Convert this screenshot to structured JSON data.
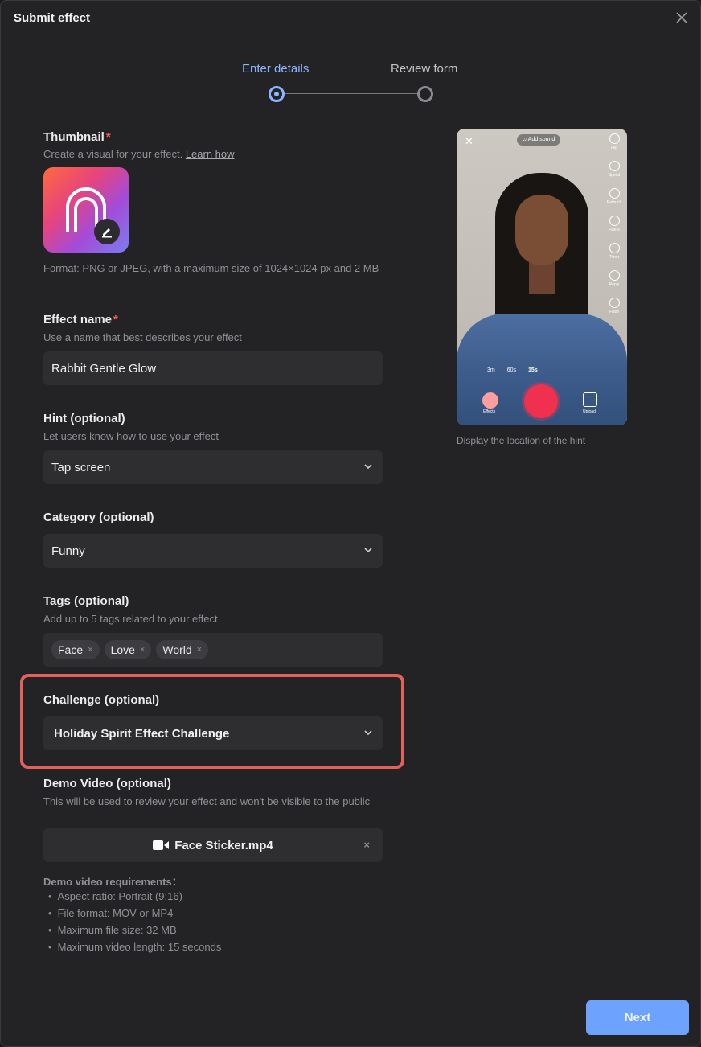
{
  "dialog": {
    "title": "Submit effect",
    "close_icon": "close-icon"
  },
  "stepper": {
    "steps": [
      {
        "label": "Enter details",
        "state": "active"
      },
      {
        "label": "Review form",
        "state": "inactive"
      }
    ]
  },
  "thumbnail": {
    "label": "Thumbnail",
    "required_mark": "*",
    "description": "Create a visual for your effect.",
    "link": "Learn how",
    "format_note": "Format: PNG or JPEG, with a maximum size of 1024×1024 px and 2 MB",
    "edit_icon": "pencil-icon"
  },
  "effect_name": {
    "label": "Effect name",
    "required_mark": "*",
    "description": "Use a name that best describes your effect",
    "value": "Rabbit Gentle Glow"
  },
  "hint": {
    "label": "Hint (optional)",
    "description": "Let users know how to use your effect",
    "value": "Tap screen"
  },
  "category": {
    "label": "Category (optional)",
    "value": "Funny"
  },
  "tags": {
    "label": "Tags (optional)",
    "description": "Add up to 5 tags related to your effect",
    "items": [
      "Face",
      "Love",
      "World"
    ],
    "remove_glyph": "×"
  },
  "challenge": {
    "label": "Challenge (optional)",
    "value": "Holiday Spirit Effect Challenge",
    "highlight_color": "#e2625a"
  },
  "demo_video": {
    "label": "Demo Video (optional)",
    "description": "This will be used to review your effect and won't be visible to the public",
    "file_name": "Face Sticker.mp4",
    "remove_glyph": "×",
    "requirements_title": "Demo video requirements：",
    "requirements": [
      "Aspect ratio: Portrait (9:16)",
      "File format: MOV or MP4",
      "Maximum file size: 32 MB",
      "Maximum video length: 15 seconds"
    ]
  },
  "preview": {
    "add_sound": "♫ Add sound",
    "side_tools": [
      "Flip",
      "Speed",
      "Retouch",
      "Filters",
      "Timer",
      "Reply",
      "Flash"
    ],
    "durations": [
      "3m",
      "60s",
      "15s"
    ],
    "effects_label": "Effects",
    "upload_label": "Upload",
    "caption": "Display the location of the hint"
  },
  "footer": {
    "next_label": "Next"
  },
  "colors": {
    "accent": "#6da3ff",
    "step_active": "#8fb4ff",
    "required": "#ff5a5a",
    "record": "#f0304f"
  }
}
